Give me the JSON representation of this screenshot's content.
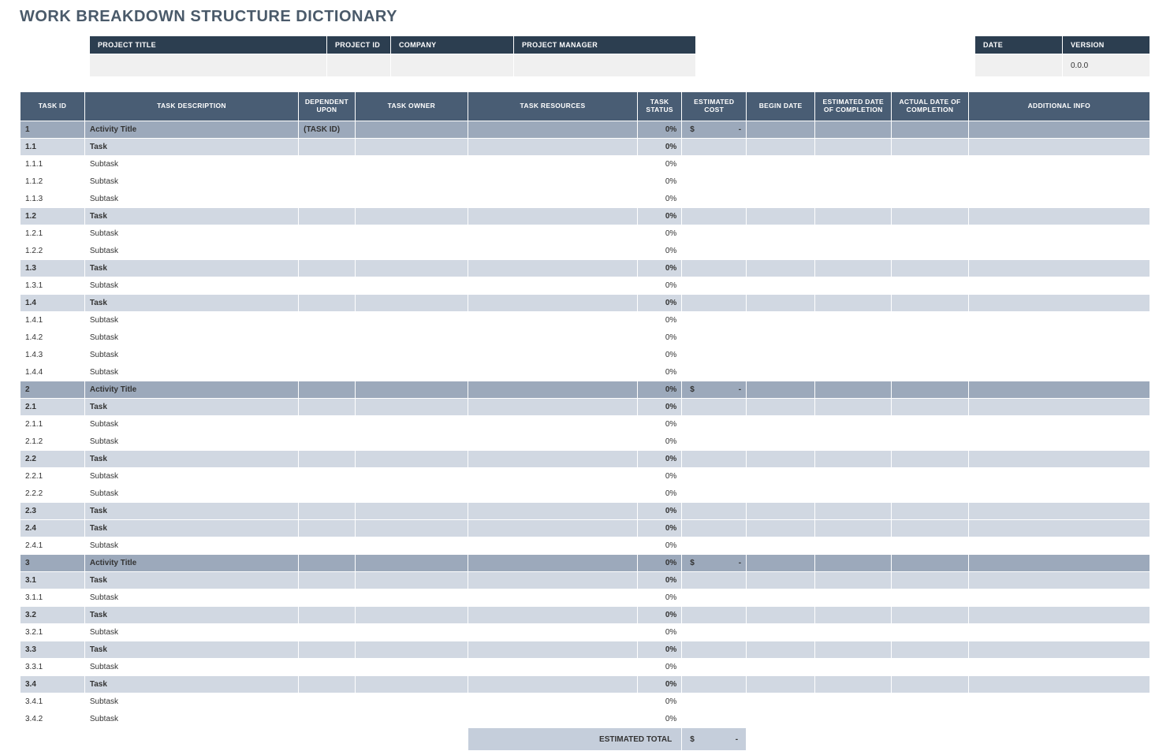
{
  "title": "WORK BREAKDOWN STRUCTURE DICTIONARY",
  "meta1": {
    "headers": [
      "PROJECT TITLE",
      "PROJECT ID",
      "COMPANY",
      "PROJECT MANAGER"
    ],
    "values": [
      "",
      "",
      "",
      ""
    ],
    "widths": [
      280,
      60,
      135,
      210
    ]
  },
  "meta2": {
    "headers": [
      "DATE",
      "VERSION"
    ],
    "values": [
      "",
      "0.0.0"
    ],
    "widths": [
      90,
      90
    ]
  },
  "columns": [
    "TASK ID",
    "TASK DESCRIPTION",
    "DEPENDENT UPON",
    "TASK OWNER",
    "TASK RESOURCES",
    "TASK STATUS",
    "ESTIMATED COST",
    "BEGIN DATE",
    "ESTIMATED DATE OF COMPLETION",
    "ACTUAL DATE OF COMPLETION",
    "ADDITIONAL INFO"
  ],
  "rows": [
    {
      "level": "activity",
      "id": "1",
      "desc": "Activity Title",
      "dep": "(TASK ID)",
      "status": "0%",
      "cost": "-",
      "showCur": true
    },
    {
      "level": "task",
      "id": "1.1",
      "desc": "Task",
      "status": "0%"
    },
    {
      "level": "subtask",
      "id": "1.1.1",
      "desc": "Subtask",
      "status": "0%"
    },
    {
      "level": "subtask",
      "id": "1.1.2",
      "desc": "Subtask",
      "status": "0%"
    },
    {
      "level": "subtask",
      "id": "1.1.3",
      "desc": "Subtask",
      "status": "0%"
    },
    {
      "level": "task",
      "id": "1.2",
      "desc": "Task",
      "status": "0%"
    },
    {
      "level": "subtask",
      "id": "1.2.1",
      "desc": "Subtask",
      "status": "0%"
    },
    {
      "level": "subtask",
      "id": "1.2.2",
      "desc": "Subtask",
      "status": "0%"
    },
    {
      "level": "task",
      "id": "1.3",
      "desc": "Task",
      "status": "0%"
    },
    {
      "level": "subtask",
      "id": "1.3.1",
      "desc": "Subtask",
      "status": "0%"
    },
    {
      "level": "task",
      "id": "1.4",
      "desc": "Task",
      "status": "0%"
    },
    {
      "level": "subtask",
      "id": "1.4.1",
      "desc": "Subtask",
      "status": "0%"
    },
    {
      "level": "subtask",
      "id": "1.4.2",
      "desc": "Subtask",
      "status": "0%"
    },
    {
      "level": "subtask",
      "id": "1.4.3",
      "desc": "Subtask",
      "status": "0%"
    },
    {
      "level": "subtask",
      "id": "1.4.4",
      "desc": "Subtask",
      "status": "0%"
    },
    {
      "level": "activity",
      "id": "2",
      "desc": "Activity Title",
      "status": "0%",
      "cost": "-",
      "showCur": true
    },
    {
      "level": "task",
      "id": "2.1",
      "desc": "Task",
      "status": "0%"
    },
    {
      "level": "subtask",
      "id": "2.1.1",
      "desc": "Subtask",
      "status": "0%"
    },
    {
      "level": "subtask",
      "id": "2.1.2",
      "desc": "Subtask",
      "status": "0%"
    },
    {
      "level": "task",
      "id": "2.2",
      "desc": "Task",
      "status": "0%"
    },
    {
      "level": "subtask",
      "id": "2.2.1",
      "desc": "Subtask",
      "status": "0%"
    },
    {
      "level": "subtask",
      "id": "2.2.2",
      "desc": "Subtask",
      "status": "0%"
    },
    {
      "level": "task",
      "id": "2.3",
      "desc": "Task",
      "status": "0%"
    },
    {
      "level": "task",
      "id": "2.4",
      "desc": "Task",
      "status": "0%"
    },
    {
      "level": "subtask",
      "id": "2.4.1",
      "desc": "Subtask",
      "status": "0%"
    },
    {
      "level": "activity",
      "id": "3",
      "desc": "Activity Title",
      "status": "0%",
      "cost": "-",
      "showCur": true
    },
    {
      "level": "task",
      "id": "3.1",
      "desc": "Task",
      "status": "0%"
    },
    {
      "level": "subtask",
      "id": "3.1.1",
      "desc": "Subtask",
      "status": "0%"
    },
    {
      "level": "task",
      "id": "3.2",
      "desc": "Task",
      "status": "0%"
    },
    {
      "level": "subtask",
      "id": "3.2.1",
      "desc": "Subtask",
      "status": "0%"
    },
    {
      "level": "task",
      "id": "3.3",
      "desc": "Task",
      "status": "0%"
    },
    {
      "level": "subtask",
      "id": "3.3.1",
      "desc": "Subtask",
      "status": "0%"
    },
    {
      "level": "task",
      "id": "3.4",
      "desc": "Task",
      "status": "0%"
    },
    {
      "level": "subtask",
      "id": "3.4.1",
      "desc": "Subtask",
      "status": "0%"
    },
    {
      "level": "subtask",
      "id": "3.4.2",
      "desc": "Subtask",
      "status": "0%"
    }
  ],
  "total": {
    "label": "ESTIMATED TOTAL",
    "value": "-",
    "cur": "$"
  }
}
